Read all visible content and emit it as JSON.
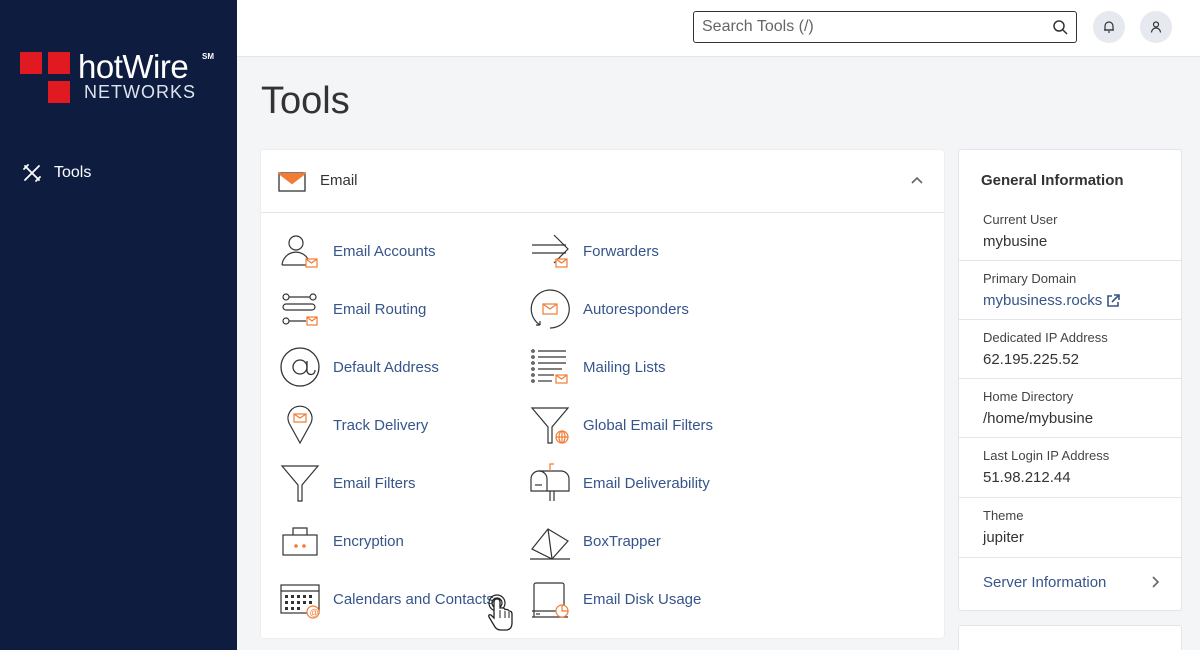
{
  "brand": {
    "name": "hotWire",
    "superscript": "SM",
    "sub": "NETWORKS",
    "red": "#e11a22",
    "sidebar_bg": "#0e1c3f"
  },
  "sidebar": {
    "items": [
      {
        "label": "Tools",
        "icon": "tools-icon"
      }
    ]
  },
  "header": {
    "search_placeholder": "Search Tools (/)",
    "icons": [
      "search-icon",
      "bell-icon",
      "user-icon"
    ]
  },
  "page": {
    "title": "Tools"
  },
  "email_section": {
    "title": "Email",
    "tools_left": [
      {
        "label": "Email Accounts",
        "icon": "email-accounts-icon"
      },
      {
        "label": "Email Routing",
        "icon": "email-routing-icon"
      },
      {
        "label": "Default Address",
        "icon": "at-sign-icon"
      },
      {
        "label": "Track Delivery",
        "icon": "map-pin-icon"
      },
      {
        "label": "Email Filters",
        "icon": "filter-icon"
      },
      {
        "label": "Encryption",
        "icon": "encryption-icon"
      },
      {
        "label": "Calendars and Contacts",
        "icon": "calendar-icon"
      }
    ],
    "tools_right": [
      {
        "label": "Forwarders",
        "icon": "forward-arrow-icon"
      },
      {
        "label": "Autoresponders",
        "icon": "autoresponder-icon"
      },
      {
        "label": "Mailing Lists",
        "icon": "mailing-list-icon"
      },
      {
        "label": "Global Email Filters",
        "icon": "global-filter-icon"
      },
      {
        "label": "Email Deliverability",
        "icon": "mailbox-icon"
      },
      {
        "label": "BoxTrapper",
        "icon": "boxtrapper-icon"
      },
      {
        "label": "Email Disk Usage",
        "icon": "disk-usage-icon"
      }
    ]
  },
  "general_info": {
    "title": "General Information",
    "rows": [
      {
        "label": "Current User",
        "value": "mybusine"
      },
      {
        "label": "Primary Domain",
        "value": "mybusiness.rocks"
      },
      {
        "label": "Dedicated IP Address",
        "value": "62.195.225.52"
      },
      {
        "label": "Home Directory",
        "value": "/home/mybusine"
      },
      {
        "label": "Last Login IP Address",
        "value": "51.98.212.44"
      },
      {
        "label": "Theme",
        "value": "jupiter"
      }
    ],
    "server_info_label": "Server Information"
  },
  "colors": {
    "link": "#36558a",
    "accent": "#f07c35"
  }
}
